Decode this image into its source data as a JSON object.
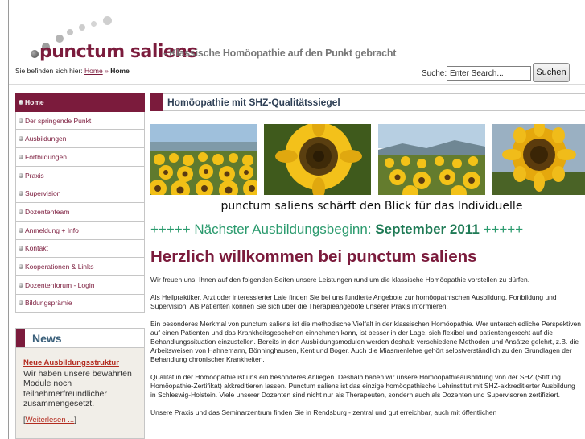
{
  "header": {
    "logo_main": "punctum saliens",
    "logo_sub": "- Klassische Homöopathie auf den Punkt gebracht",
    "logo_colors": {
      "brand": "#7b1b3c",
      "dots_dark": "#555555",
      "dots_light": "#cfcfcf"
    }
  },
  "breadcrumb": {
    "prefix": "Sie befinden sich hier:",
    "home_link": "Home",
    "separator": "»",
    "current": "Home"
  },
  "search": {
    "label": "Suche:",
    "input_value": "Enter Search...",
    "button_label": "Suchen"
  },
  "nav": {
    "items": [
      {
        "label": "Home",
        "active": true
      },
      {
        "label": "Der springende Punkt"
      },
      {
        "label": "Ausbildungen"
      },
      {
        "label": "Fortbildungen"
      },
      {
        "label": "Praxis"
      },
      {
        "label": "Supervision"
      },
      {
        "label": "Dozententeam"
      },
      {
        "label": "Anmeldung + Info"
      },
      {
        "label": "Kontakt"
      },
      {
        "label": "Kooperationen & Links"
      },
      {
        "label": "Dozentenforum - Login"
      },
      {
        "label": "Bildungsprämie"
      }
    ]
  },
  "news": {
    "title": "News",
    "link": "Neue Ausbildungsstruktur",
    "text": "Wir haben unsere bewährten Module noch teilnehmerfreundlicher zusammengesetzt.",
    "more_open": "[",
    "more_link": "Weiterlesen ...",
    "more_close": "]"
  },
  "main": {
    "section_title": "Homöopathie mit SHZ-Qualitätssiegel",
    "tagline": "punctum saliens schärft den Blick für das Individuelle",
    "announce_prefix": "+++++ Nächster Ausbildungsbeginn:",
    "announce_date": "September 2011",
    "announce_suffix": "+++++",
    "welcome": "Herzlich willkommen bei punctum saliens",
    "paragraphs": [
      "Wir freuen uns, Ihnen auf den folgenden Seiten unsere Leistungen rund um die klassische Homöopathie vorstellen zu dürfen.",
      "Als Heilpraktiker, Arzt oder interessierter Laie finden Sie bei uns fundierte Angebote zur homöopathischen Ausbildung, Fortbildung und Supervision. Als Patienten können Sie sich über die Therapieangebote unserer Praxis informieren.",
      "Ein besonderes Merkmal von punctum saliens ist die methodische Vielfalt in der klassischen Homöopathie. Wer unterschiedliche Perspektiven auf einen Patienten und das Krankheitsgeschehen einnehmen kann, ist besser in der Lage, sich flexibel und patientengerecht auf die Behandlungssituation einzustellen. Bereits in den Ausbildungsmodulen werden deshalb verschiedene Methoden und Ansätze gelehrt, z.B. die Arbeitsweisen von Hahnemann, Bönninghausen, Kent und Boger. Auch die Miasmenlehre gehört selbstverständlich zu den Grundlagen der Behandlung chronischer Krankheiten.",
      "Qualität in der Homöopathie ist uns ein besonderes Anliegen. Deshalb haben wir unsere Homöopathieausbildung von der SHZ (Stiftung Homöopathie-Zertifikat) akkreditieren lassen. Punctum saliens ist das einzige homöopathische Lehrinstitut mit SHZ-akkreditierter Ausbildung in Schleswig-Holstein. Viele unserer Dozenten sind nicht nur als Therapeuten, sondern auch als Dozenten und Supervisoren zertifiziert.",
      "Unsere Praxis und das Seminarzentrum finden Sie in Rendsburg - zentral und gut erreichbar, auch mit öffentlichen"
    ]
  },
  "photos": [
    {
      "name": "sunflower-field-photo-1"
    },
    {
      "name": "sunflower-closeup-photo"
    },
    {
      "name": "sunflower-field-photo-2"
    },
    {
      "name": "sunflower-sky-photo"
    }
  ]
}
